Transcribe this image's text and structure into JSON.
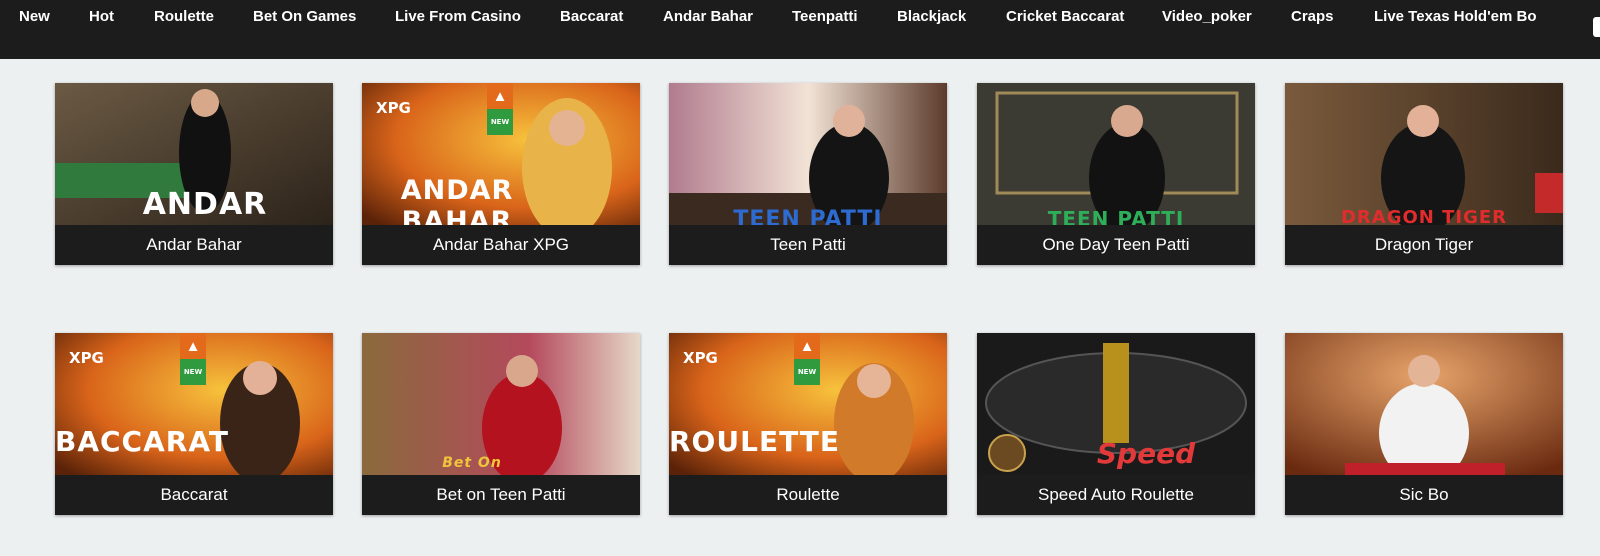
{
  "nav": {
    "items": [
      "New",
      "Hot",
      "Roulette",
      "Bet On Games",
      "Live From Casino",
      "Baccarat",
      "Andar Bahar",
      "Teenpatti",
      "Blackjack",
      "Cricket Baccarat",
      "Video_poker",
      "Craps",
      "Live Texas Hold'em Bo"
    ]
  },
  "games": [
    {
      "title": "Andar Bahar",
      "thumb_text": "ANDAR BAHAR",
      "badge": false,
      "provider": ""
    },
    {
      "title": "Andar Bahar XPG",
      "thumb_text": "ANDAR BAHAR",
      "badge": true,
      "provider": "XPG"
    },
    {
      "title": "Teen Patti",
      "thumb_text": "TEEN PATTI",
      "badge": false,
      "provider": ""
    },
    {
      "title": "One Day Teen Patti",
      "thumb_text": "TEEN PATTI",
      "badge": false,
      "provider": ""
    },
    {
      "title": "Dragon Tiger",
      "thumb_text": "DRAGON TIGER",
      "badge": false,
      "provider": ""
    },
    {
      "title": "Baccarat",
      "thumb_text": "BACCARAT",
      "badge": true,
      "provider": "XPG"
    },
    {
      "title": "Bet on Teen Patti",
      "thumb_text": "Bet On",
      "badge": false,
      "provider": ""
    },
    {
      "title": "Roulette",
      "thumb_text": "ROULETTE",
      "badge": true,
      "provider": "XPG"
    },
    {
      "title": "Speed Auto Roulette",
      "thumb_text": "Speed Roulette",
      "badge": false,
      "provider": ""
    },
    {
      "title": "Sic Bo",
      "thumb_text": "",
      "badge": false,
      "provider": ""
    }
  ],
  "badge_labels": {
    "new": "NEW"
  },
  "icons": {
    "hot": "fire-icon",
    "new": "new-badge-icon"
  },
  "colors": {
    "nav_bg": "#1c1c1c",
    "page_bg": "#edf0f1",
    "caption_bg": "#1c1c1c",
    "hot": "#e46a1b",
    "new": "#2f9a3e"
  }
}
